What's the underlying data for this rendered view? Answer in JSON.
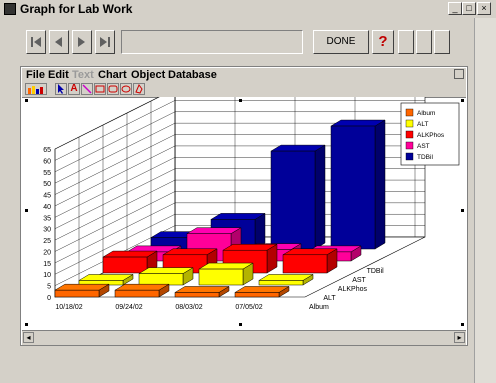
{
  "window": {
    "title": "Graph for Lab Work"
  },
  "toolbar": {
    "done_label": "DONE",
    "help_label": "?"
  },
  "menu": [
    "File",
    "Edit",
    "Text",
    "Chart",
    "Object",
    "Database"
  ],
  "tools": [
    "chart-type-icon",
    "arrow-select-icon",
    "text-tool-icon",
    "line-tool-icon",
    "rectangle-tool-icon",
    "rounded-rectangle-tool-icon",
    "oval-tool-icon",
    "polygon-tool-icon"
  ],
  "chart_data": {
    "type": "bar",
    "subtype": "3d-clustered",
    "categories": [
      "10/18/02",
      "09/24/02",
      "08/03/02",
      "07/05/02"
    ],
    "series": [
      {
        "name": "Album",
        "color": "#ff6600",
        "values": [
          3,
          3,
          2,
          2
        ]
      },
      {
        "name": "ALT",
        "color": "#ffff00",
        "values": [
          2,
          5,
          7,
          2
        ]
      },
      {
        "name": "ALKPhos",
        "color": "#ff0000",
        "values": [
          7,
          8,
          10,
          8
        ]
      },
      {
        "name": "AST",
        "color": "#ff0099",
        "values": [
          4,
          12,
          5,
          4
        ]
      },
      {
        "name": "TDBil",
        "color": "#000099",
        "values": [
          5,
          13,
          43,
          54
        ]
      }
    ],
    "yticks": [
      "0",
      "5",
      "10",
      "15",
      "20",
      "25",
      "30",
      "35",
      "40",
      "45",
      "50",
      "55",
      "60",
      "65"
    ],
    "ylim": [
      0,
      65
    ],
    "depth_labels": [
      "Album",
      "ALT",
      "ALKPhos",
      "AST",
      "TDBil"
    ],
    "grid": true,
    "legend_position": "top-right"
  }
}
